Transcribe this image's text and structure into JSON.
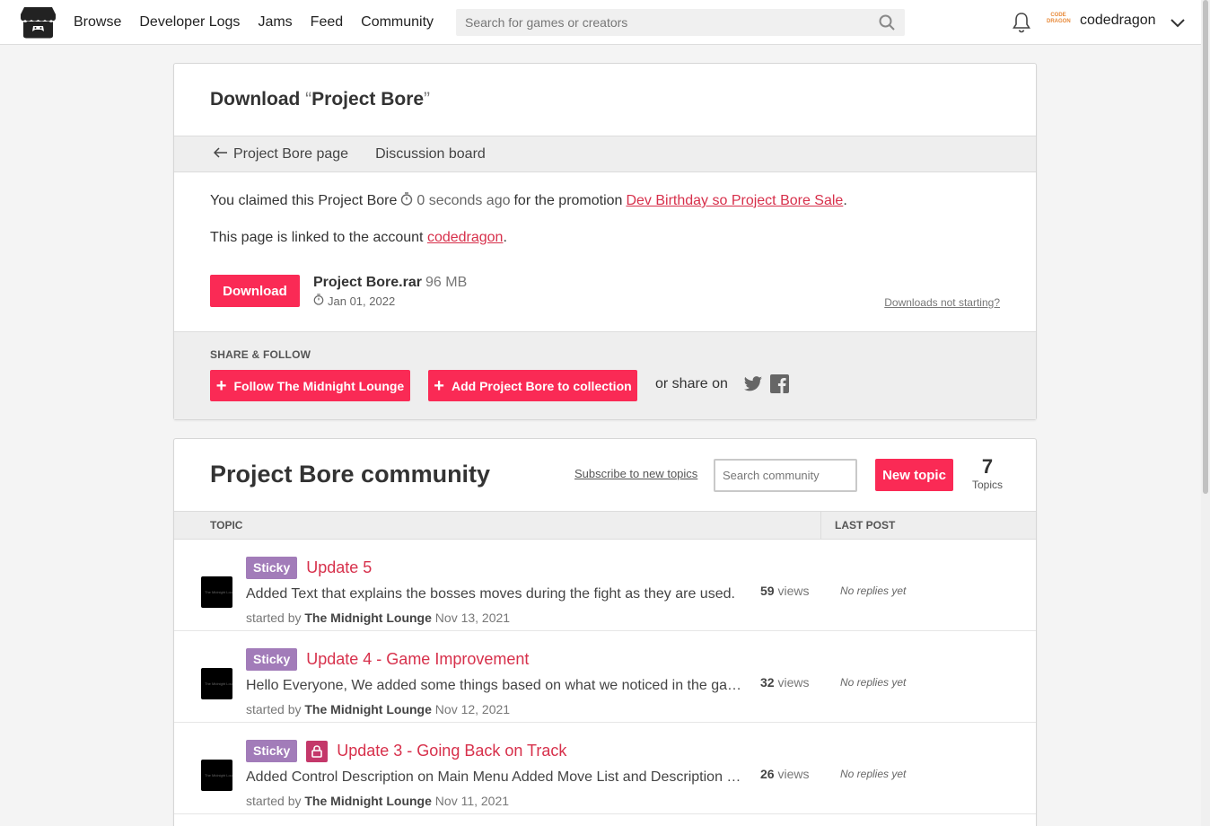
{
  "header": {
    "nav": [
      "Browse",
      "Developer Logs",
      "Jams",
      "Feed",
      "Community"
    ],
    "search_placeholder": "Search for games or creators",
    "username": "codedragon",
    "avatar_text": "CODE DRAGON"
  },
  "download": {
    "title_prefix": "Download ",
    "quote_open": "“",
    "title_name": "Project Bore",
    "quote_close": "”",
    "nav_back": "Project Bore page",
    "nav_discussion": "Discussion board",
    "claim_prefix": "You claimed this Project Bore",
    "claim_time": "0 seconds ago",
    "claim_mid": "for the promotion",
    "promotion": "Dev Birthday so Project Bore Sale",
    "claim_end": ".",
    "linked_prefix": "This page is linked to the account",
    "linked_account": "codedragon",
    "linked_end": ".",
    "button": "Download",
    "file_name": "Project Bore.rar",
    "file_size": "96 MB",
    "file_date": "Jan 01, 2022",
    "not_starting": "Downloads not starting?"
  },
  "share": {
    "label": "SHARE & FOLLOW",
    "follow": "Follow The Midnight Lounge",
    "collection": "Add Project Bore to collection",
    "share_on": "or share on"
  },
  "community": {
    "title": "Project Bore community",
    "subscribe": "Subscribe to new topics",
    "search_placeholder": "Search community",
    "new_topic": "New topic",
    "topic_count": "7",
    "topic_count_label": "Topics",
    "col_topic": "TOPIC",
    "col_last_post": "LAST POST",
    "topics": [
      {
        "badge": "Sticky",
        "locked": false,
        "title": "Update 5",
        "excerpt": "Added Text that explains the bosses moves during the fight as they are used.",
        "started_by": "started by",
        "author": "The Midnight Lounge",
        "date": "Nov 13, 2021",
        "views": "59",
        "views_label": "views",
        "last_post": "No replies yet"
      },
      {
        "badge": "Sticky",
        "locked": false,
        "title": "Update 4 - Game Improvement",
        "excerpt": "Hello Everyone, We added some things based on what we noticed in the game…",
        "started_by": "started by",
        "author": "The Midnight Lounge",
        "date": "Nov 12, 2021",
        "views": "32",
        "views_label": "views",
        "last_post": "No replies yet"
      },
      {
        "badge": "Sticky",
        "locked": true,
        "title": "Update 3 - Going Back on Track",
        "excerpt": "Added Control Description on Main Menu Added Move List and Description …",
        "started_by": "started by",
        "author": "The Midnight Lounge",
        "date": "Nov 11, 2021",
        "views": "26",
        "views_label": "views",
        "last_post": "No replies yet"
      }
    ]
  },
  "colors": {
    "accent": "#fa2a55",
    "link": "#d7304b",
    "sticky": "#a27cb9",
    "lock": "#c4386a"
  },
  "icons": [
    "itchio-logo-icon",
    "search-icon",
    "bell-icon",
    "chevron-down-icon",
    "arrow-left-icon",
    "stopwatch-icon",
    "plus-icon",
    "twitter-icon",
    "facebook-icon",
    "lock-icon"
  ]
}
